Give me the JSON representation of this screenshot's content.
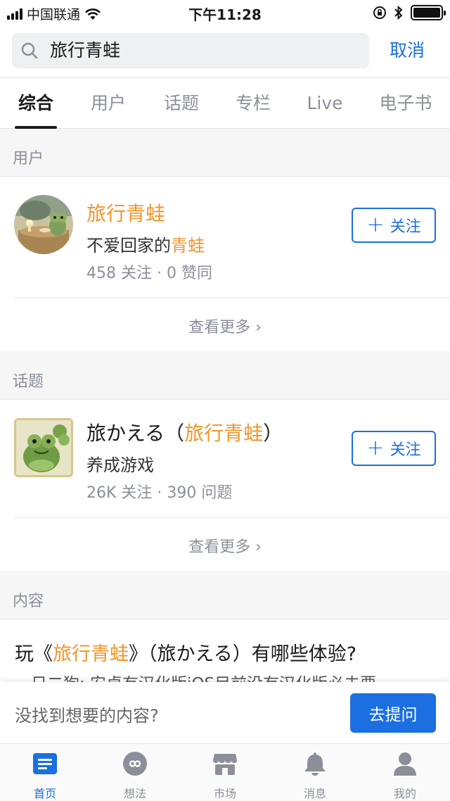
{
  "status_bar": {
    "carrier": "中国联通",
    "time": "下午11:28"
  },
  "search": {
    "query": "旅行青蛙",
    "cancel_label": "取消"
  },
  "tabs": [
    {
      "label": "综合",
      "active": true
    },
    {
      "label": "用户",
      "active": false
    },
    {
      "label": "话题",
      "active": false
    },
    {
      "label": "专栏",
      "active": false
    },
    {
      "label": "Live",
      "active": false
    },
    {
      "label": "电子书",
      "active": false
    }
  ],
  "users_section": {
    "header": "用户",
    "item": {
      "name": "旅行青蛙",
      "bio_prefix": "不爱回家的",
      "bio_highlight": "青蛙",
      "meta": "458 关注 · 0 赞同",
      "follow_label": "关注"
    },
    "more_label": "查看更多 ›"
  },
  "topics_section": {
    "header": "话题",
    "item": {
      "title_prefix": "旅かえる（",
      "title_highlight": "旅行青蛙",
      "title_suffix": "）",
      "subtitle": "养成游戏",
      "meta": "26K 关注 · 390 问题",
      "follow_label": "关注"
    },
    "more_label": "查看更多 ›"
  },
  "content_section": {
    "header": "内容",
    "item": {
      "title_prefix": "玩《",
      "title_highlight": "旅行青蛙",
      "title_suffix": "》（旅かえる）有哪些体验?",
      "snippet": "一日二狗: 安卓有汉化版iOS目前没有汉化版必去要"
    }
  },
  "ask_bar": {
    "prompt": "没找到想要的内容?",
    "button_label": "去提问"
  },
  "tab_bar": [
    {
      "label": "首页",
      "icon": "home-icon",
      "active": true
    },
    {
      "label": "想法",
      "icon": "idea-icon",
      "active": false
    },
    {
      "label": "市场",
      "icon": "market-icon",
      "active": false
    },
    {
      "label": "消息",
      "icon": "bell-icon",
      "active": false
    },
    {
      "label": "我的",
      "icon": "profile-icon",
      "active": false
    }
  ],
  "colors": {
    "accent": "#1b6fe0",
    "highlight": "#f0962a",
    "muted": "#8a8f99"
  }
}
